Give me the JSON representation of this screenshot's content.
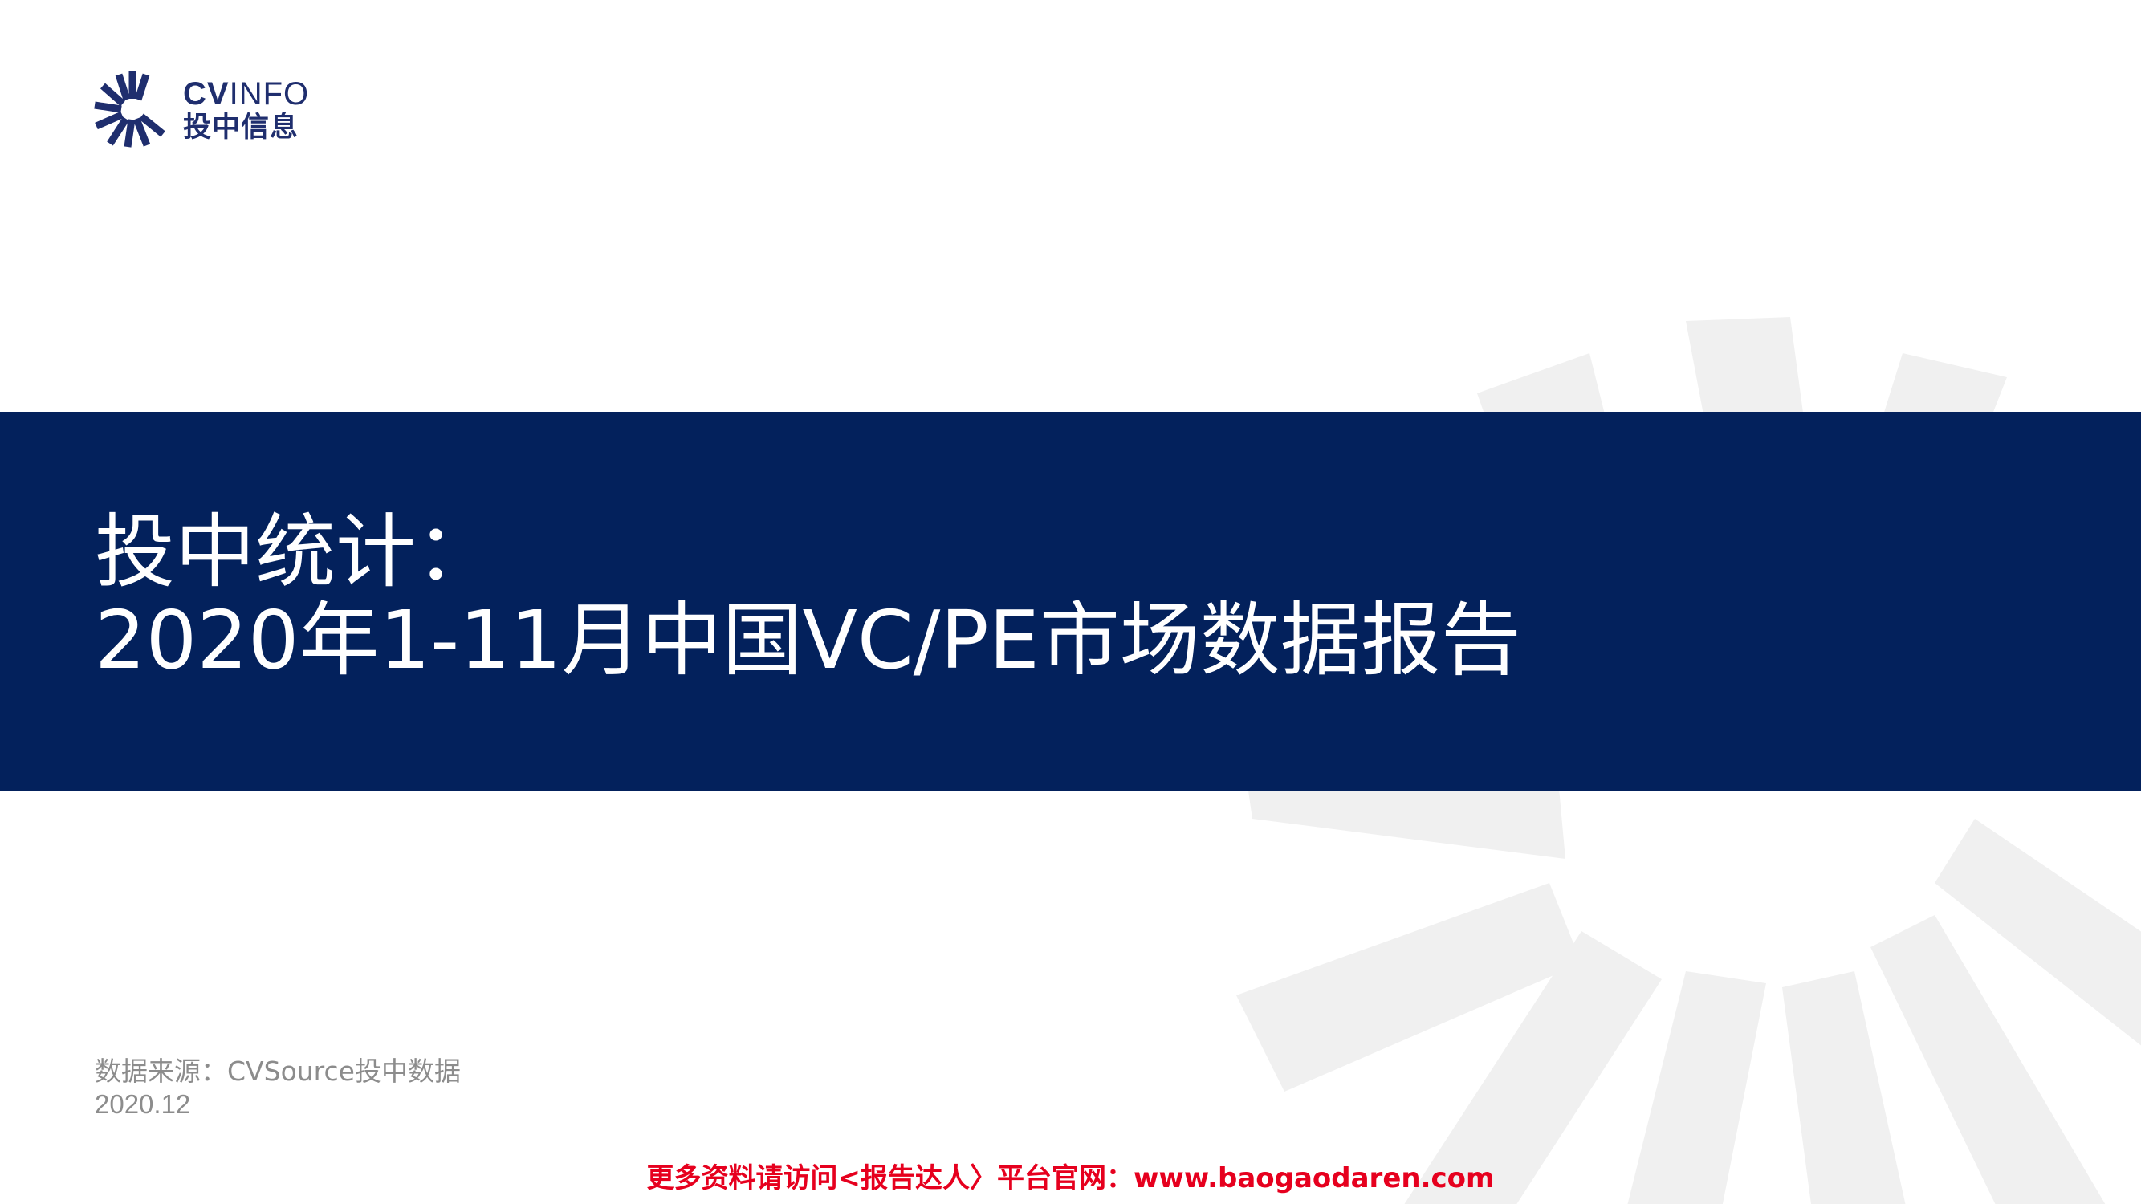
{
  "logo": {
    "brand_bold": "CV",
    "brand_light": "INFO",
    "brand_cn": "投中信息",
    "mark_icon": "starburst-logo-icon",
    "color": "#1f2e6e"
  },
  "title": {
    "line1": "投中统计：",
    "line2": "2020年1-11月中国VC/PE市场数据报告"
  },
  "source": "数据来源：CVSource投中数据",
  "date": "2020.12",
  "promo": "更多资料请访问<报告达人〉平台官网：www.baogaodaren.com",
  "colors": {
    "band": "#03215c",
    "watermark": "#f0f0f0",
    "promo": "#e6001e",
    "muted_text": "#8c8c8c"
  }
}
